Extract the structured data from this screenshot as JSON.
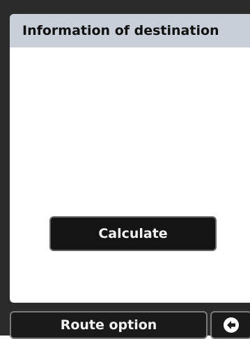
{
  "panel": {
    "title": "Information of destination"
  },
  "buttons": {
    "calculate_label": "Calculate",
    "route_option_label": "Route option"
  },
  "icons": {
    "back": "back-arrow-icon"
  },
  "colors": {
    "header_bg": "#c9cfd8",
    "frame": "#2b2b2b",
    "button_bg": "#141414"
  }
}
